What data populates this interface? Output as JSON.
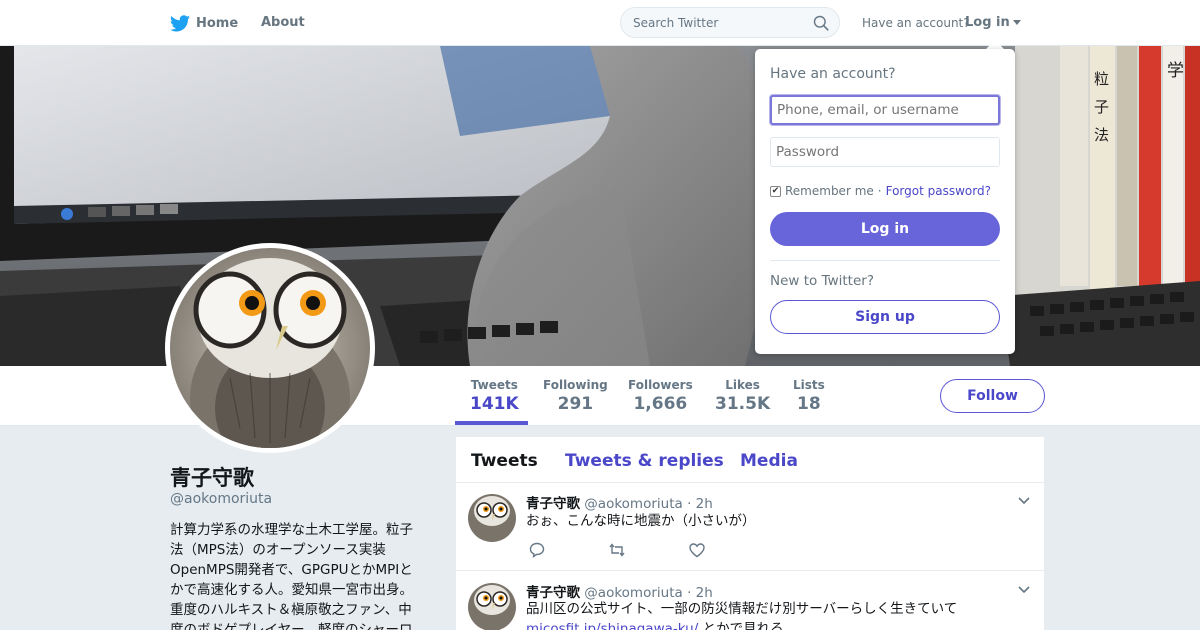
{
  "nav": {
    "home_label": "Home",
    "about_label": "About",
    "search_placeholder": "Search Twitter",
    "have_account": "Have an account?",
    "login_label": "Log in"
  },
  "profile": {
    "name": "青子守歌",
    "handle": "@aokomoriuta",
    "bio_lines": [
      "計算力学系の水理学な土木工学屋。粒子",
      "法（MPS法）のオープンソース実装",
      "OpenMPS開発者で、GPGPUとかMPIと",
      "かで高速化する人。愛知県一宮市出身。",
      "重度のハルキスト＆槇原敬之ファン、中",
      "度のボドゲプレイヤー、軽度のシャーロ"
    ]
  },
  "stats": [
    {
      "label": "Tweets",
      "value": "141K"
    },
    {
      "label": "Following",
      "value": "291"
    },
    {
      "label": "Followers",
      "value": "1,666"
    },
    {
      "label": "Likes",
      "value": "31.5K"
    },
    {
      "label": "Lists",
      "value": "18"
    }
  ],
  "follow_label": "Follow",
  "timeline": {
    "tabs": [
      "Tweets",
      "Tweets & replies",
      "Media"
    ],
    "tweets": [
      {
        "name": "青子守歌",
        "handle": "@aokomoriuta",
        "time": "· 2h",
        "text": "おぉ、こんな時に地震か（小さいが）"
      },
      {
        "name": "青子守歌",
        "handle": "@aokomoriuta",
        "time": "· 2h",
        "text": "品川区の公式サイト、一部の防災情報だけ別サーバーらしく生きていて",
        "link": "micosfit.jp/shinagawa-ku/",
        "text_after": " とかで見れる"
      }
    ]
  },
  "login_dropdown": {
    "title": "Have an account?",
    "username_placeholder": "Phone, email, or username",
    "password_placeholder": "Password",
    "remember": "Remember me",
    "separator": "·",
    "forgot": "Forgot password?",
    "login_button": "Log in",
    "new_to_twitter": "New to Twitter?",
    "signup_button": "Sign up"
  },
  "colors": {
    "accent": "#5a57d5",
    "accent_text": "#4a47c9",
    "background": "#e6ecf0",
    "twitter_blue": "#1da1f2"
  }
}
